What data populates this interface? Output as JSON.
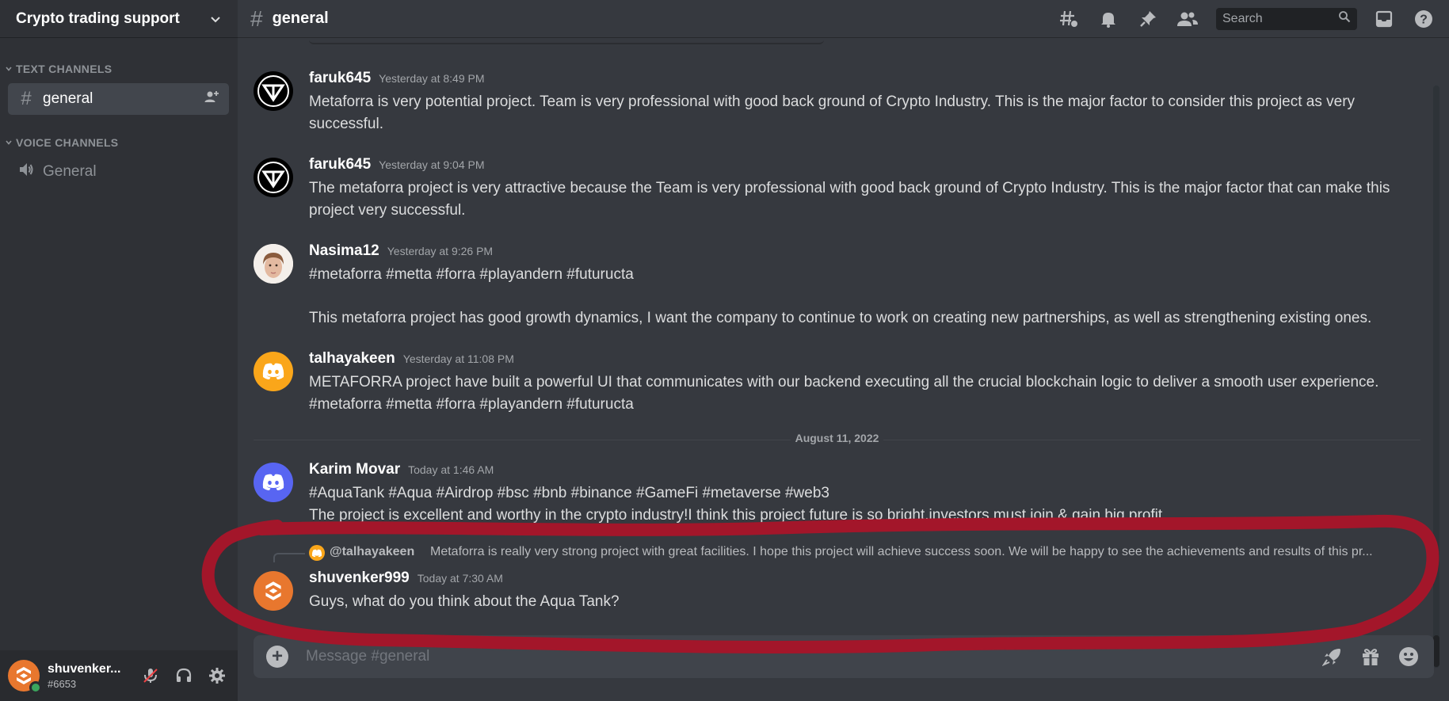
{
  "server": {
    "name": "Crypto trading support"
  },
  "sidebar": {
    "categories": [
      {
        "label": "TEXT CHANNELS"
      },
      {
        "label": "VOICE CHANNELS"
      }
    ],
    "channels": [
      {
        "name": "general",
        "type": "text",
        "selected": true
      },
      {
        "name": "General",
        "type": "voice",
        "selected": false
      }
    ]
  },
  "topbar": {
    "channel_name": "general",
    "search_placeholder": "Search",
    "icons": [
      "threads-icon",
      "notification-bell-icon",
      "pin-icon",
      "member-list-icon",
      "inbox-icon",
      "help-icon"
    ]
  },
  "messages": [
    {
      "author": "faruk645",
      "timestamp": "Yesterday at 8:49 PM",
      "avatar": "metaforra-logo",
      "lines": [
        "Metaforra is very potential project. Team is very professional with good back ground of Crypto Industry. This is the major factor to consider this project as very",
        "successful."
      ]
    },
    {
      "author": "faruk645",
      "timestamp": "Yesterday at 9:04 PM",
      "avatar": "metaforra-logo",
      "lines": [
        "The metaforra project is very attractive because the Team is very professional with good back ground of Crypto Industry. This is the major factor that can make this",
        "project very successful."
      ]
    },
    {
      "author": "Nasima12",
      "timestamp": "Yesterday at 9:26 PM",
      "avatar": "photo",
      "lines": [
        "#metaforra #metta #forra #playandern #futuructa",
        "",
        "This metaforra project has good growth dynamics, I want the company to continue to work on creating new partnerships, as well as strengthening existing ones."
      ]
    },
    {
      "author": "talhayakeen",
      "timestamp": "Yesterday at 11:08 PM",
      "avatar": "discord-orange",
      "lines": [
        "METAFORRA project  have built a powerful UI that communicates with our backend executing all the crucial blockchain logic to deliver a smooth user experience.",
        "#metaforra #metta #forra #playandern #futuructa"
      ]
    },
    {
      "author": "Karim Movar",
      "timestamp": "Today at 1:46 AM",
      "avatar": "discord-blurple",
      "lines": [
        "#AquaTank #Aqua #Airdrop #bsc #bnb #binance #GameFi #metaverse #web3",
        "The project is excellent and worthy in the crypto industry!I think this project future is so bright.investors must join & gain big profit."
      ]
    },
    {
      "author": "shuvenker999",
      "timestamp": "Today at 7:30 AM",
      "avatar": "orange-logo",
      "lines": [
        "Guys, what do you think about the Aqua Tank?"
      ]
    }
  ],
  "date_divider": "August 11, 2022",
  "reply": {
    "user": "@talhayakeen",
    "text": "Metaforra is really very  strong project with great facilities. I hope this project will achieve success soon. We will be happy to see the achievements and results of this pr..."
  },
  "composer": {
    "placeholder": "Message #general"
  },
  "user_panel": {
    "username": "shuvenker...",
    "tag": "#6653",
    "status": "online"
  },
  "colors": {
    "background": "#36393f",
    "sidebar": "#2f3136",
    "user_panel": "#292b2f",
    "annotation": "#a3162a",
    "online": "#3ba55d",
    "blurple": "#5865f2",
    "orange": "#faa61a"
  }
}
